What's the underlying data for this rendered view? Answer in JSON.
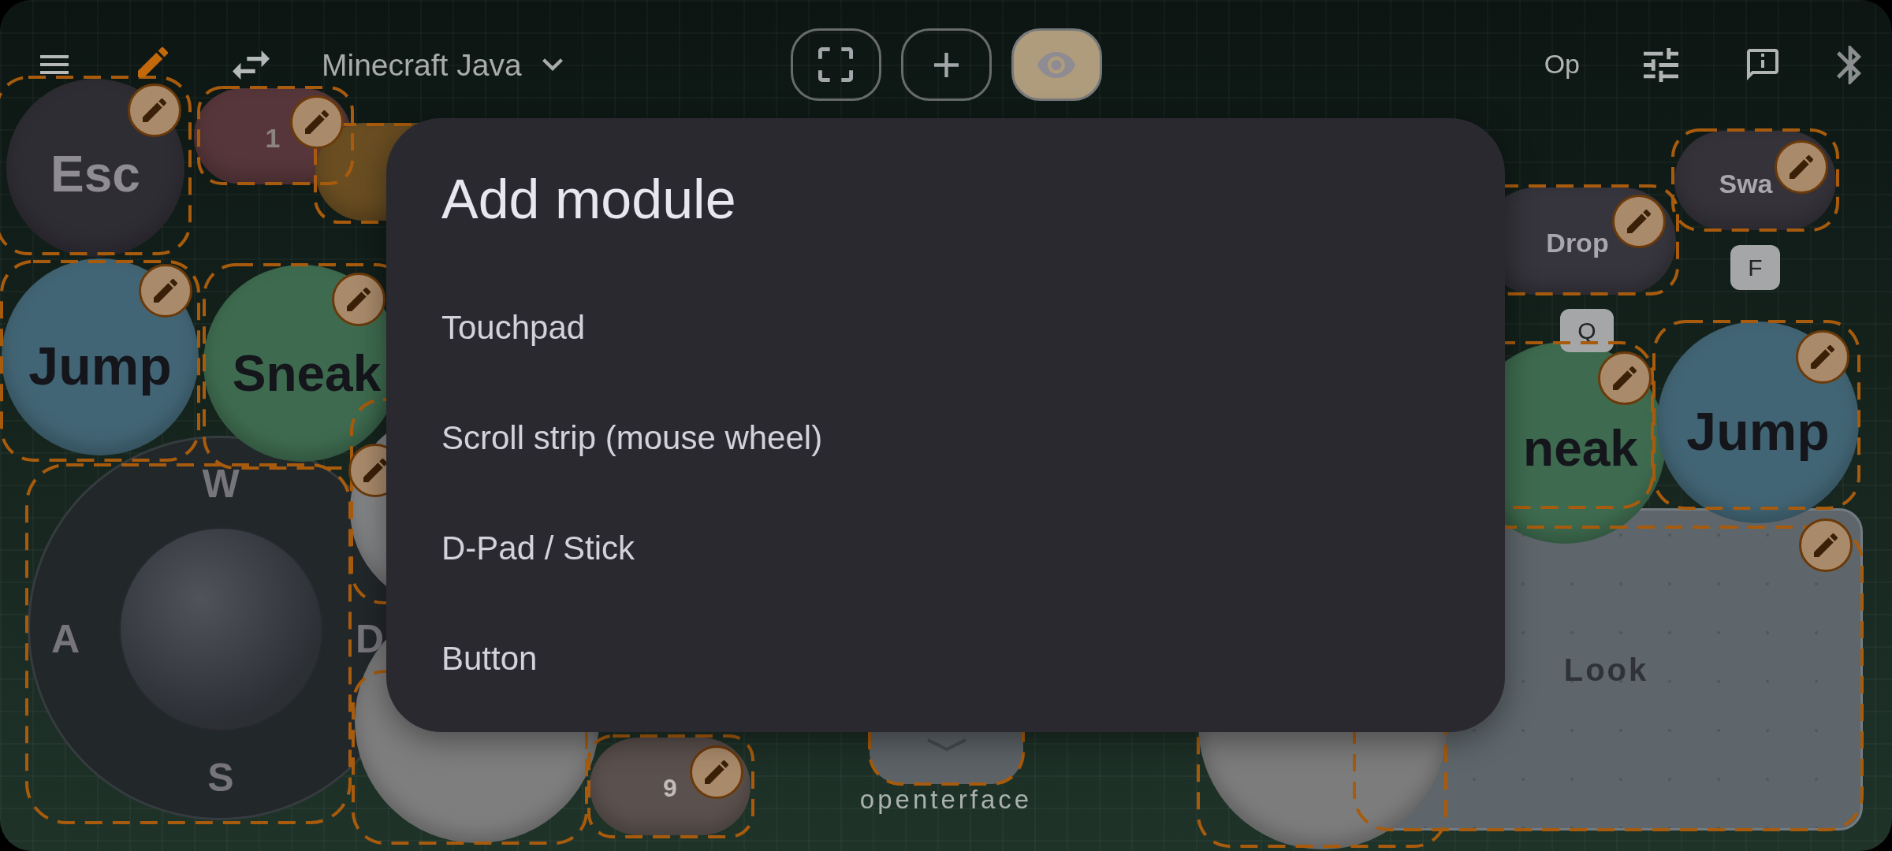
{
  "toolbar": {
    "edit_mode": true,
    "layout_name": "Minecraft Java",
    "view_buttons": [
      {
        "kind": "fullscreen",
        "selected": false
      },
      {
        "kind": "add",
        "selected": false
      },
      {
        "kind": "preview",
        "selected": true
      }
    ],
    "op_label": "Op"
  },
  "modules": [
    {
      "kind": "round",
      "label": "Esc",
      "color": "#2f2d34"
    },
    {
      "kind": "pill",
      "label": "1",
      "color": "#56363a"
    },
    {
      "kind": "pill",
      "color": "#6a4e22"
    },
    {
      "kind": "round",
      "label": "Jump",
      "color": "#426575"
    },
    {
      "kind": "round",
      "label": "Sneak",
      "color": "#3e6b4f"
    },
    {
      "kind": "joystick",
      "keys": {
        "up": "W",
        "left": "A",
        "down": "S",
        "right": "D"
      }
    },
    {
      "kind": "round",
      "color": "#848586"
    },
    {
      "kind": "round",
      "color": "#7e7e7e"
    },
    {
      "kind": "pill",
      "label": "9",
      "color": "#5a504d"
    },
    {
      "kind": "strip",
      "color": "#5c6266"
    },
    {
      "kind": "pill",
      "label": "Swa",
      "key": "F",
      "color": "#35323a"
    },
    {
      "kind": "pill",
      "label": "Drop",
      "key": "Q",
      "color": "#36343c"
    },
    {
      "kind": "round",
      "label": "neak",
      "color": "#3e6b4f"
    },
    {
      "kind": "round",
      "label": "Jump",
      "color": "#426575"
    },
    {
      "kind": "round",
      "color": "#7c7c7c"
    },
    {
      "kind": "touchpad",
      "label": "Look",
      "color": "#5e666b"
    }
  ],
  "brand": "openterface",
  "dialog": {
    "title": "Add module",
    "items": [
      "Touchpad",
      "Scroll strip (mouse wheel)",
      "D-Pad / Stick",
      "Button"
    ]
  }
}
